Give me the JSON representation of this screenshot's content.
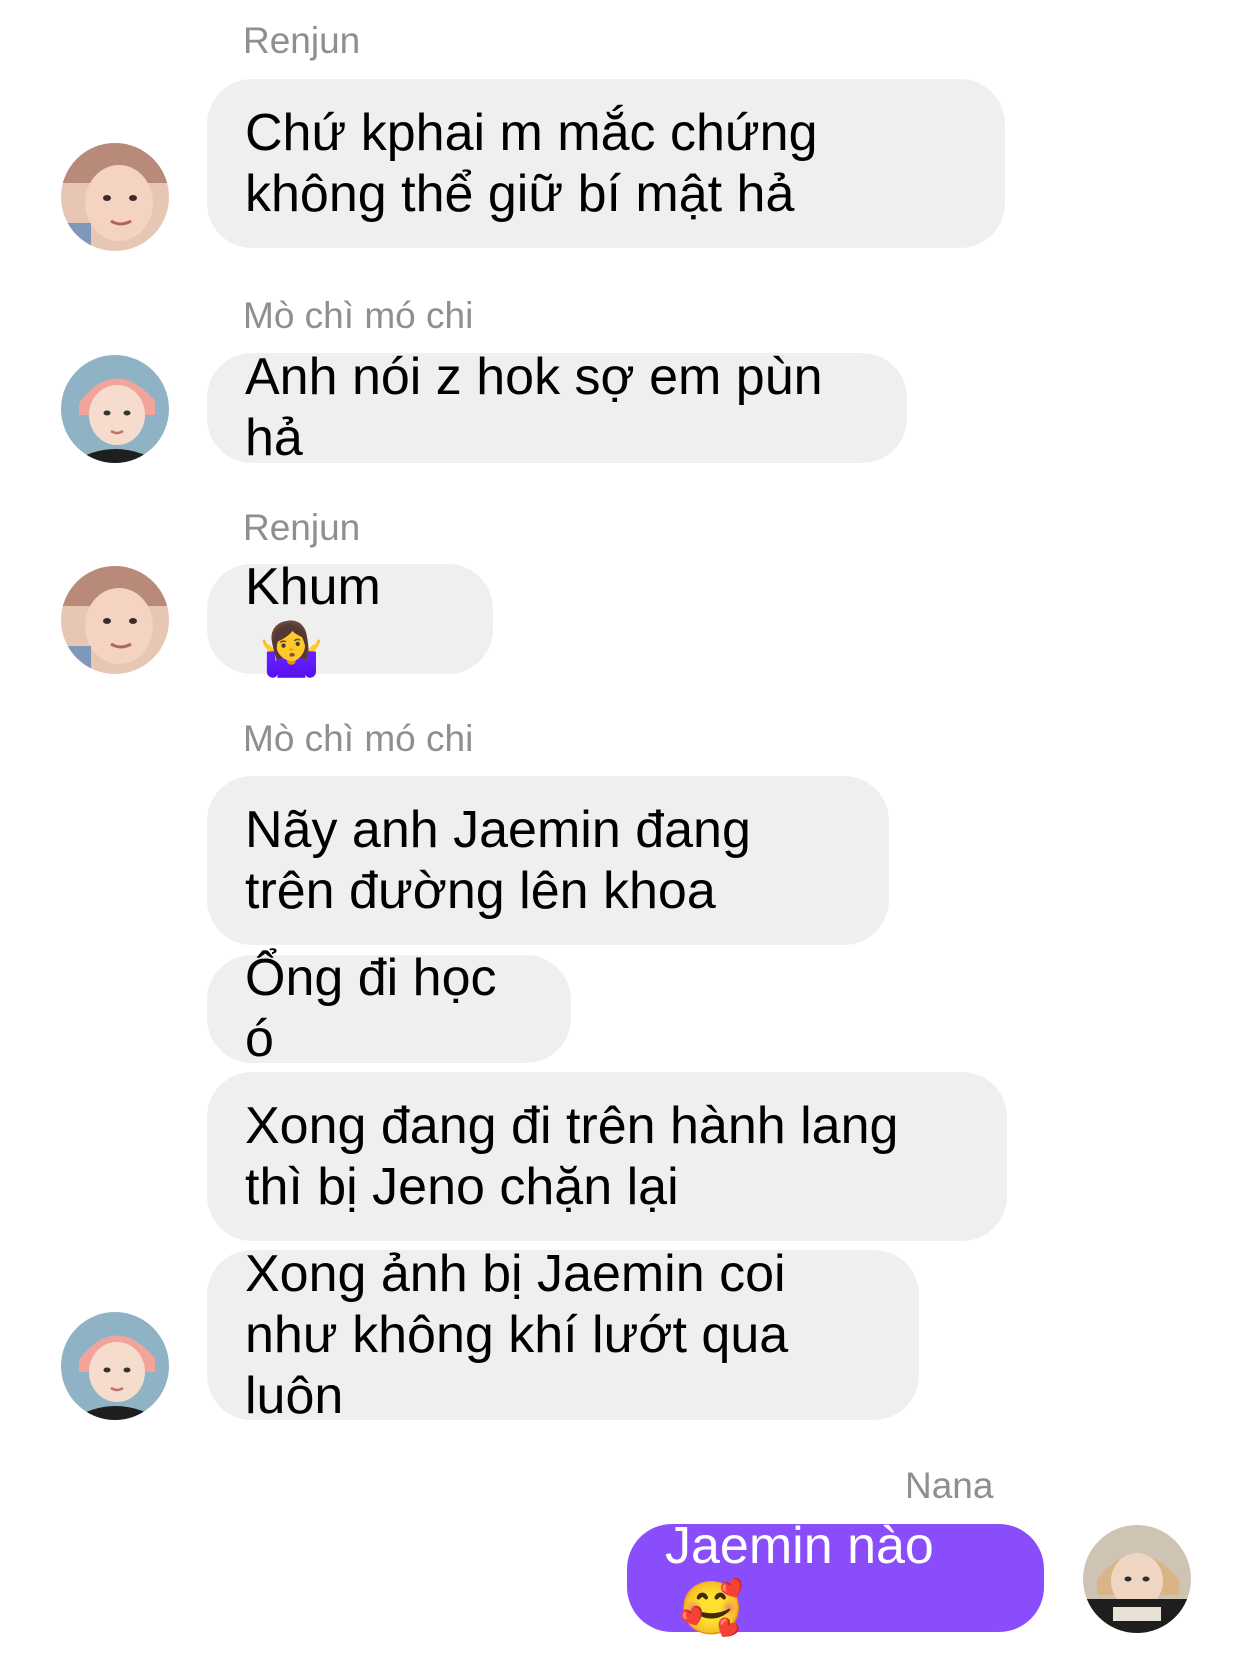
{
  "messages": [
    {
      "sender": "Renjun",
      "text": "Chứ kphai m mắc chứng không thể giữ bí mật hả"
    },
    {
      "sender": "Mò chì mó chi",
      "text": "Anh nói z hok sợ em pùn hả"
    },
    {
      "sender": "Renjun",
      "text": "Khum",
      "emoji": "🤷‍♀️",
      "emoji_name": "person-shrugging-icon"
    },
    {
      "sender": "Mò chì mó chi",
      "text": "Nãy anh Jaemin đang trên đường lên khoa"
    },
    {
      "text": "Ổng đi học ó"
    },
    {
      "text": "Xong đang đi trên hành lang thì bị Jeno chặn lại"
    },
    {
      "text": "Xong ảnh bị Jaemin coi như không khí lướt qua luôn"
    },
    {
      "sender": "Nana",
      "text": "Jaemin nào",
      "emoji": "🥰",
      "emoji_name": "smiling-face-with-hearts-icon",
      "outgoing": true
    }
  ],
  "colors": {
    "incoming_bubble": "#efefef",
    "outgoing_bubble": "#8a4dfc",
    "sender_name": "#8e8e93"
  }
}
